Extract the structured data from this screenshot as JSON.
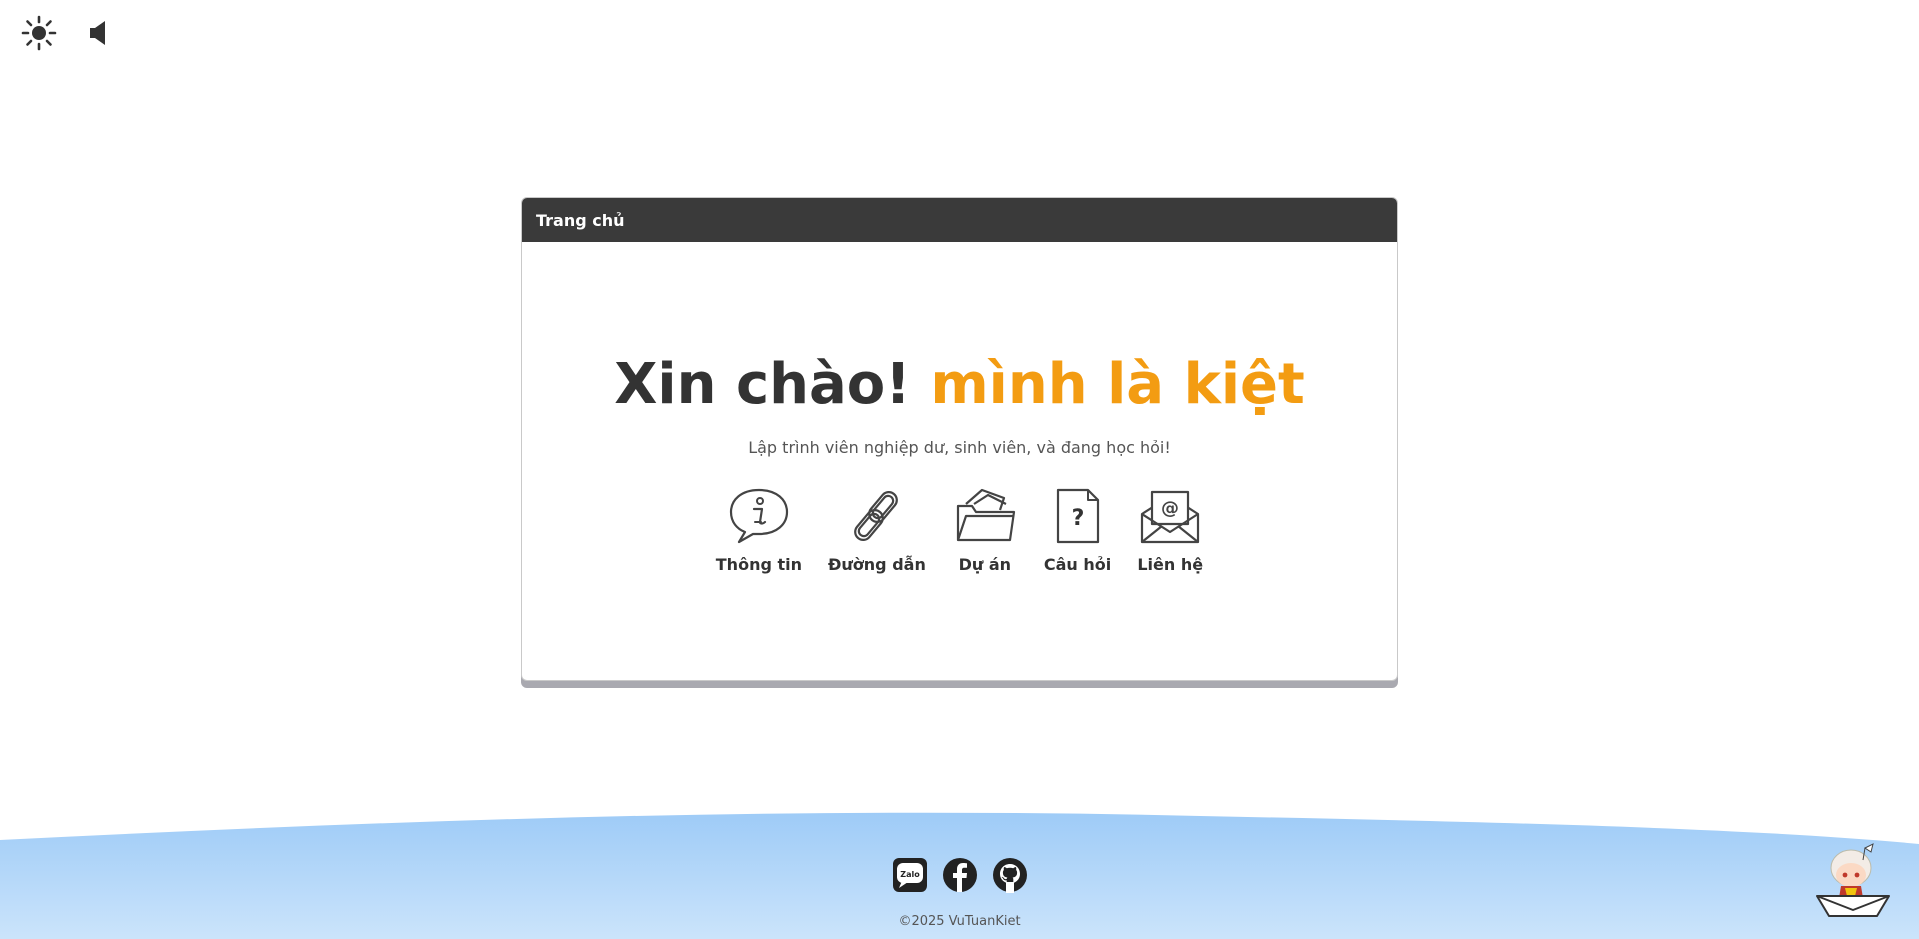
{
  "controls": {
    "theme_icon": "sun-icon",
    "sound_icon": "speaker-icon"
  },
  "window": {
    "title": "Trang chủ"
  },
  "hero": {
    "greeting": "Xin chào!",
    "name": "mình là kiệt",
    "subtitle": "Lập trình viên nghiệp dư, sinh viên, và đang học hỏi!"
  },
  "nav": [
    {
      "label": "Thông tin",
      "icon": "info-speech-bubble-icon"
    },
    {
      "label": "Đường dẫn",
      "icon": "link-chain-icon"
    },
    {
      "label": "Dự án",
      "icon": "folder-icon"
    },
    {
      "label": "Câu hỏi",
      "icon": "question-document-icon"
    },
    {
      "label": "Liên hệ",
      "icon": "mail-at-icon"
    }
  ],
  "footer": {
    "socials": [
      {
        "name": "Zalo",
        "icon": "zalo-icon"
      },
      {
        "name": "Facebook",
        "icon": "facebook-icon"
      },
      {
        "name": "GitHub",
        "icon": "github-icon"
      }
    ],
    "zalo_text": "Zalo",
    "copyright": "©2025 VuTuanKiet"
  },
  "colors": {
    "accent": "#f39c12",
    "titlebar": "#3a3a3a",
    "wave_top": "#9ecbf7",
    "wave_bottom": "#c9e3fb"
  }
}
